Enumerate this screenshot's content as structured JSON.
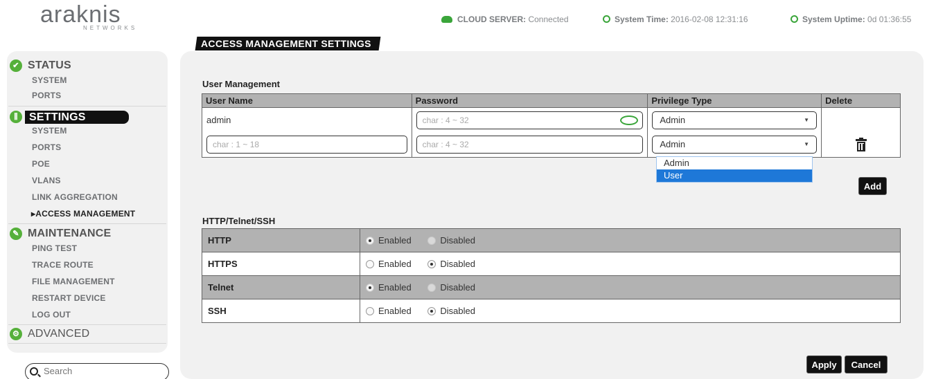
{
  "header": {
    "logo_text": "araknis",
    "logo_sub": "NETWORKS",
    "cloud_label": "CLOUD SERVER:",
    "cloud_value": "Connected",
    "time_label": "System Time:",
    "time_value": "2016-02-08 12:31:16",
    "uptime_label": "System Uptime:",
    "uptime_value": "0d 01:36:55",
    "page_title": "ACCESS MANAGEMENT SETTINGS"
  },
  "sidebar": {
    "status": {
      "label": "STATUS",
      "items": [
        "SYSTEM",
        "PORTS"
      ]
    },
    "settings": {
      "label": "SETTINGS",
      "items": [
        "SYSTEM",
        "PORTS",
        "POE",
        "VLANS",
        "LINK AGGREGATION",
        "▸ACCESS MANAGEMENT"
      ]
    },
    "maintenance": {
      "label": "MAINTENANCE",
      "items": [
        "PING TEST",
        "TRACE ROUTE",
        "FILE MANAGEMENT",
        "RESTART DEVICE",
        "LOG OUT"
      ]
    },
    "advanced": {
      "label": "ADVANCED"
    },
    "search_placeholder": "Search"
  },
  "user_mgmt": {
    "title": "User Management",
    "columns": [
      "User Name",
      "Password",
      "Privilege Type",
      "Delete"
    ],
    "row1": {
      "user": "admin",
      "password_placeholder": "char : 4 ~ 32",
      "privilege": "Admin"
    },
    "row2": {
      "user_placeholder": "char : 1 ~ 18",
      "password_placeholder": "char : 4 ~ 32",
      "privilege": "Admin"
    },
    "dropdown_options": [
      "Admin",
      "User"
    ],
    "dropdown_selected": "User",
    "add_label": "Add"
  },
  "protocols": {
    "title": "HTTP/Telnet/SSH",
    "enabled_label": "Enabled",
    "disabled_label": "Disabled",
    "rows": [
      {
        "name": "HTTP",
        "state": "Enabled"
      },
      {
        "name": "HTTPS",
        "state": "Disabled"
      },
      {
        "name": "Telnet",
        "state": "Enabled"
      },
      {
        "name": "SSH",
        "state": "Disabled"
      }
    ]
  },
  "actions": {
    "apply_label": "Apply",
    "cancel_label": "Cancel"
  },
  "colors": {
    "accent_green": "#3aa53a",
    "dropdown_highlight": "#1e78d8",
    "header_grey": "#b2b2b2"
  }
}
